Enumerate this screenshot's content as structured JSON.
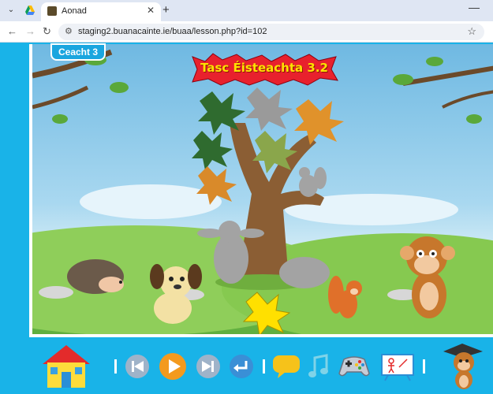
{
  "browser": {
    "tab_title": "Aonad",
    "url": "staging2.buanacainte.ie/buaa/lesson.php?id=102",
    "icons": {
      "tab_search": "chevron-down-icon",
      "new_tab": "plus-icon",
      "minimize": "minimize-icon",
      "back": "back-arrow-icon",
      "forward": "forward-arrow-icon",
      "reload": "reload-icon",
      "site_info": "site-info-icon",
      "bookmark": "star-icon"
    }
  },
  "lesson": {
    "badge": "Ceacht 3",
    "title": "Tasc Éisteachta 3.2"
  },
  "scene": {
    "items": [
      "tree",
      "autumn-leaves",
      "shadow-leaves",
      "squirrel-shadow",
      "rabbit-shadow",
      "hedgehog-shadow",
      "hedgehog",
      "dog",
      "yellow-leaf",
      "squirrel",
      "monkey"
    ]
  },
  "controls": {
    "icons": [
      "home-icon",
      "skip-back-icon",
      "play-icon",
      "skip-forward-icon",
      "return-icon",
      "speech-bubble-icon",
      "music-note-icon",
      "gamepad-icon",
      "whiteboard-icon",
      "monkey-graduate-icon"
    ]
  },
  "colors": {
    "frame": "#19b3e8",
    "title": "#ffe100",
    "burst": "#e8212d"
  }
}
